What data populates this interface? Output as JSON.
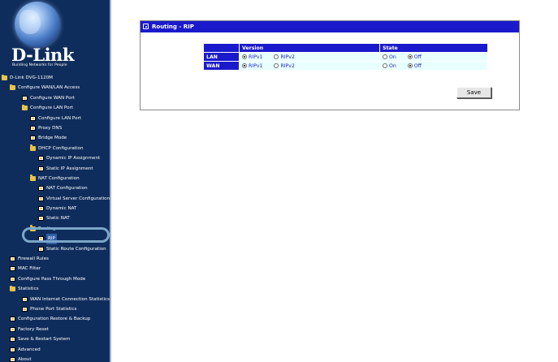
{
  "brand": {
    "name": "D-Link",
    "tagline": "Building Networks for People"
  },
  "nav": [
    {
      "label": "D-Link DVG-1120M",
      "icon": "folder-icon",
      "level": 0,
      "clickable": true
    },
    {
      "label": "Configure WAN/LAN Access",
      "icon": "folder-icon",
      "level": 1,
      "clickable": true
    },
    {
      "label": "Configure WAN Port",
      "icon": "document-icon",
      "level": 2,
      "clickable": true
    },
    {
      "label": "Configure LAN Port",
      "icon": "folder-icon",
      "level": 2,
      "clickable": true
    },
    {
      "label": "Configure LAN Port",
      "icon": "document-icon",
      "level": 3,
      "clickable": true
    },
    {
      "label": "Proxy DNS",
      "icon": "document-icon",
      "level": 3,
      "clickable": true
    },
    {
      "label": "Bridge Mode",
      "icon": "document-icon",
      "level": 3,
      "clickable": true
    },
    {
      "label": "DHCP Configuration",
      "icon": "folder-icon",
      "level": 3,
      "clickable": true
    },
    {
      "label": "Dynamic IP Assignment",
      "icon": "document-icon",
      "level": 4,
      "clickable": true
    },
    {
      "label": "Static IP Assignment",
      "icon": "document-icon",
      "level": 4,
      "clickable": true
    },
    {
      "label": "NAT Configuration",
      "icon": "folder-icon",
      "level": 3,
      "clickable": true
    },
    {
      "label": "NAT Configuration",
      "icon": "document-icon",
      "level": 4,
      "clickable": true
    },
    {
      "label": "Virtual Server Configuration",
      "icon": "document-icon",
      "level": 4,
      "clickable": true
    },
    {
      "label": "Dynamic NAT",
      "icon": "document-icon",
      "level": 4,
      "clickable": true
    },
    {
      "label": "Static NAT",
      "icon": "document-icon",
      "level": 4,
      "clickable": true
    },
    {
      "label": "Routing",
      "icon": "folder-icon",
      "level": 3,
      "clickable": true
    },
    {
      "label": "RIP",
      "icon": "document-icon",
      "level": 4,
      "clickable": true,
      "selected": true
    },
    {
      "label": "Static Route Configuration",
      "icon": "document-icon",
      "level": 4,
      "clickable": true
    },
    {
      "label": "Firewall Rules",
      "icon": "document-icon",
      "level": 1,
      "clickable": true
    },
    {
      "label": "MAC Filter",
      "icon": "document-icon",
      "level": 1,
      "clickable": true
    },
    {
      "label": "Configure Pass Through Mode",
      "icon": "document-icon",
      "level": 1,
      "clickable": true
    },
    {
      "label": "Statistics",
      "icon": "folder-icon",
      "level": 1,
      "clickable": true
    },
    {
      "label": "WAN Internet Connection Statistics",
      "icon": "document-icon",
      "level": 2,
      "clickable": true
    },
    {
      "label": "Phone Port Statistics",
      "icon": "document-icon",
      "level": 2,
      "clickable": true
    },
    {
      "label": "Configuration Restore & Backup",
      "icon": "document-icon",
      "level": 1,
      "clickable": true
    },
    {
      "label": "Factory Reset",
      "icon": "document-icon",
      "level": 1,
      "clickable": true
    },
    {
      "label": "Save & Restart System",
      "icon": "document-icon",
      "level": 1,
      "clickable": true
    },
    {
      "label": "Advanced",
      "icon": "document-icon",
      "level": 1,
      "clickable": true
    },
    {
      "label": "About",
      "icon": "document-icon",
      "level": 1,
      "clickable": true
    }
  ],
  "panel": {
    "title": "Routing - RIP",
    "table": {
      "headers": {
        "row": "",
        "version": "Version",
        "state": "State"
      },
      "rows": [
        {
          "label": "LAN",
          "version": [
            {
              "label": "RIPv1",
              "checked": true
            },
            {
              "label": "RIPv2",
              "checked": false
            }
          ],
          "state": [
            {
              "label": "On",
              "checked": false
            },
            {
              "label": "Off",
              "checked": true
            }
          ]
        },
        {
          "label": "WAN",
          "version": [
            {
              "label": "RIPv1",
              "checked": true
            },
            {
              "label": "RIPv2",
              "checked": false
            }
          ],
          "state": [
            {
              "label": "On",
              "checked": false
            },
            {
              "label": "Off",
              "checked": true
            }
          ]
        }
      ]
    },
    "save_label": "Save"
  },
  "colors": {
    "sidebar_bg": "#0f2d5c",
    "header_blue": "#1a1acc",
    "cell_bg": "#e8ffff",
    "highlight_ring": "#7aa6c8"
  }
}
